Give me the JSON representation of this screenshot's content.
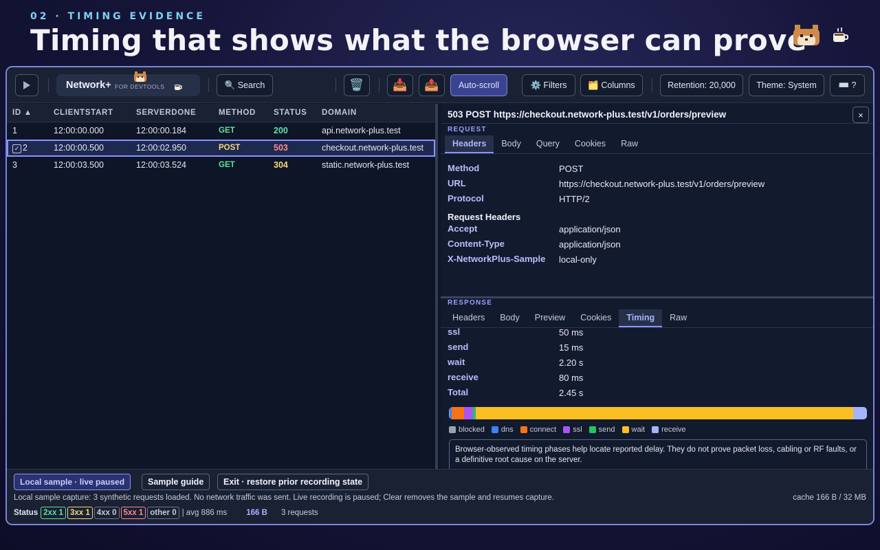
{
  "slide": {
    "eyebrow": "02 · TIMING EVIDENCE",
    "headline": "Timing that shows what the browser can prove"
  },
  "toolbar": {
    "brand_name": "Network+",
    "brand_sub": "FOR DEVTOOLS",
    "search_label": "🔍 Search",
    "auto_scroll_label": "Auto-scroll",
    "filters_label": "⚙️ Filters",
    "columns_label": "🗂️ Columns",
    "retention_label": "Retention: 20,000",
    "theme_label": "Theme: System",
    "shortcuts_label": "⌨️ ?",
    "clear_icon": "🗑️",
    "import_icon": "📥",
    "export_icon": "📤"
  },
  "table": {
    "columns": [
      "ID ▲",
      "CLIENTSTART",
      "SERVERDONE",
      "METHOD",
      "STATUS",
      "DOMAIN"
    ],
    "rows": [
      {
        "id": "1",
        "clientstart": "12:00:00.000",
        "serverdone": "12:00:00.184",
        "method": "GET",
        "status": "200",
        "domain": "api.network-plus.test"
      },
      {
        "id": "2",
        "clientstart": "12:00:00.500",
        "serverdone": "12:00:02.950",
        "method": "POST",
        "status": "503",
        "domain": "checkout.network-plus.test"
      },
      {
        "id": "3",
        "clientstart": "12:00:03.500",
        "serverdone": "12:00:03.524",
        "method": "GET",
        "status": "304",
        "domain": "static.network-plus.test"
      }
    ]
  },
  "detail": {
    "title": "503 POST https://checkout.network-plus.test/v1/orders/preview",
    "close": "×",
    "request_label": "REQUEST",
    "request_tabs": [
      "Headers",
      "Body",
      "Query",
      "Cookies",
      "Raw"
    ],
    "request_fields": [
      {
        "k": "Method",
        "v": "POST"
      },
      {
        "k": "URL",
        "v": "https://checkout.network-plus.test/v1/orders/preview"
      },
      {
        "k": "Protocol",
        "v": "HTTP/2"
      }
    ],
    "request_headers_title": "Request Headers",
    "request_headers": [
      {
        "k": "Accept",
        "v": "application/json"
      },
      {
        "k": "Content-Type",
        "v": "application/json"
      },
      {
        "k": "X-NetworkPlus-Sample",
        "v": "local-only"
      }
    ],
    "response_label": "RESPONSE",
    "response_tabs": [
      "Headers",
      "Body",
      "Preview",
      "Cookies",
      "Timing",
      "Raw"
    ],
    "timing_rows": [
      {
        "k": "ssl",
        "v": "50 ms"
      },
      {
        "k": "send",
        "v": "15 ms"
      },
      {
        "k": "wait",
        "v": "2.20 s"
      },
      {
        "k": "receive",
        "v": "80 ms"
      },
      {
        "k": "Total",
        "v": "2.45 s"
      }
    ],
    "timing_phases": [
      {
        "name": "blocked",
        "ms": 5,
        "color": "#9aa3b5"
      },
      {
        "name": "dns",
        "ms": 10,
        "color": "#3b82f6"
      },
      {
        "name": "connect",
        "ms": 75,
        "color": "#f97316"
      },
      {
        "name": "ssl",
        "ms": 50,
        "color": "#a855f7"
      },
      {
        "name": "send",
        "ms": 15,
        "color": "#22c55e"
      },
      {
        "name": "wait",
        "ms": 2200,
        "color": "#fbbf24"
      },
      {
        "name": "receive",
        "ms": 80,
        "color": "#a5b4fc"
      }
    ],
    "note": "Browser-observed timing phases help locate reported delay. They do not prove packet loss, cabling or RF faults, or a definitive root cause on the server."
  },
  "footer": {
    "pill": "Local sample · live paused",
    "guide": "Sample guide",
    "exit": "Exit · restore prior recording state",
    "note": "Local sample capture: 3 synthetic requests loaded. No network traffic was sent. Live recording is paused; Clear removes the sample and resumes capture.",
    "cache": "cache 166 B / 32 MB",
    "status_label": "Status",
    "chips": [
      "2xx 1",
      "3xx 1",
      "4xx 0",
      "5xx 1",
      "other 0"
    ],
    "avg": "| avg 886 ms",
    "size": "166 B",
    "count": "3 requests"
  }
}
